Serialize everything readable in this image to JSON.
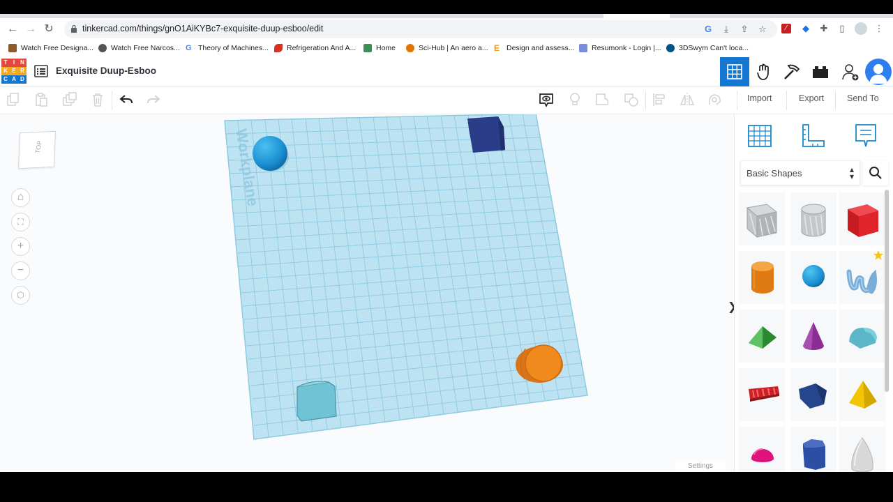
{
  "browser": {
    "url": "tinkercad.com/things/gnO1AiKYBc7-exquisite-duup-esboo/edit",
    "bookmarks": [
      {
        "label": "Watch Free Designa...",
        "icon": "film-icon",
        "color": "#8b5a2b"
      },
      {
        "label": "Watch Free Narcos...",
        "icon": "globe-icon",
        "color": "#555555"
      },
      {
        "label": "Theory of Machines...",
        "icon": "google-icon",
        "color": "#4285f4"
      },
      {
        "label": "Refrigeration And A...",
        "icon": "flame-icon",
        "color": "#d93025"
      },
      {
        "label": "Home",
        "icon": "home-icon",
        "color": "#3c8d5a"
      },
      {
        "label": "Sci-Hub | An aero a...",
        "icon": "scihub-icon",
        "color": "#e37400"
      },
      {
        "label": "Design and assess...",
        "icon": "e-icon",
        "color": "#f29900"
      },
      {
        "label": "Resumonk - Login |...",
        "icon": "resumonk-icon",
        "color": "#7b8cde"
      },
      {
        "label": "3DSwym Can't loca...",
        "icon": "3dswym-icon",
        "color": "#005386"
      }
    ]
  },
  "app": {
    "logo_letters": [
      "T",
      "I",
      "N",
      "K",
      "E",
      "R",
      "C",
      "A",
      "D"
    ],
    "logo_colors": [
      "#e2483d",
      "#e2483d",
      "#e2483d",
      "#f7a823",
      "#f7a823",
      "#f7a823",
      "#1477d1",
      "#1477d1",
      "#1477d1"
    ],
    "design_title": "Exquisite Duup-Esboo",
    "header_buttons": [
      "grid-view-icon",
      "sim-lab-icon",
      "bricks-icon",
      "blocks-icon",
      "add-user-icon"
    ]
  },
  "toolbar": {
    "import_label": "Import",
    "export_label": "Export",
    "send_to_label": "Send To"
  },
  "workspace": {
    "viewcube_label": "TOP",
    "workplane_label": "Workplane",
    "settings_label": "Settings",
    "view_buttons": [
      "home-view-icon",
      "fit-view-icon",
      "zoom-in-icon",
      "zoom-out-icon",
      "perspective-icon"
    ]
  },
  "shapes_panel": {
    "category": "Basic Shapes",
    "shapes": [
      {
        "name": "box-hole",
        "color": "#b9bcc1"
      },
      {
        "name": "cylinder-hole",
        "color": "#c4c6ca"
      },
      {
        "name": "box",
        "color": "#e0242c"
      },
      {
        "name": "cylinder",
        "color": "#f08a1c"
      },
      {
        "name": "sphere",
        "color": "#1a8fd1"
      },
      {
        "name": "scribble",
        "color": "#7aaed9"
      },
      {
        "name": "roof",
        "color": "#3aa53f"
      },
      {
        "name": "cone",
        "color": "#8b2d93"
      },
      {
        "name": "round-roof",
        "color": "#5bb7c8"
      },
      {
        "name": "text",
        "color": "#cc2127"
      },
      {
        "name": "wedge",
        "color": "#25458c"
      },
      {
        "name": "pyramid",
        "color": "#f2c500"
      },
      {
        "name": "half-sphere",
        "color": "#e0127e"
      },
      {
        "name": "polygon",
        "color": "#2d4fa3"
      },
      {
        "name": "paraboloid",
        "color": "#d8d8d8"
      }
    ]
  },
  "colors": {
    "accent": "#1477d1",
    "workplane": "#bde3f2",
    "grid": "#8ec9e2"
  }
}
